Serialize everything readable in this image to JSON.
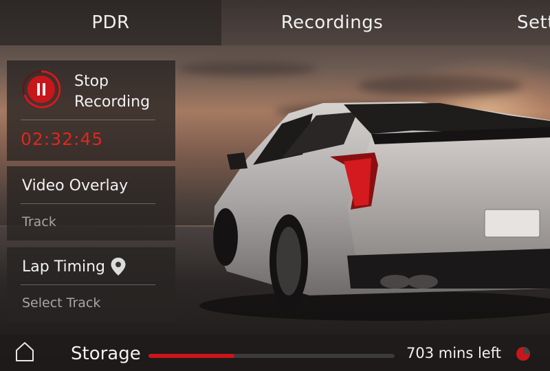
{
  "tabs": {
    "pdr": "PDR",
    "recordings": "Recordings",
    "settings": "Sett"
  },
  "record": {
    "label_line1": "Stop",
    "label_line2": "Recording",
    "elapsed": "02:32:45"
  },
  "overlay": {
    "title": "Video Overlay",
    "value": "Track"
  },
  "lap": {
    "title": "Lap Timing",
    "value": "Select Track"
  },
  "storage": {
    "label": "Storage",
    "remaining": "703 mins left",
    "used_fraction": 0.35
  },
  "colors": {
    "accent_red": "#e0261f",
    "panel_bg": "rgba(40,36,35,0.78)"
  },
  "icons": {
    "record": "pause-record-icon",
    "lap": "location-pin-icon",
    "home": "home-icon",
    "storage": "storage-pie-icon"
  }
}
